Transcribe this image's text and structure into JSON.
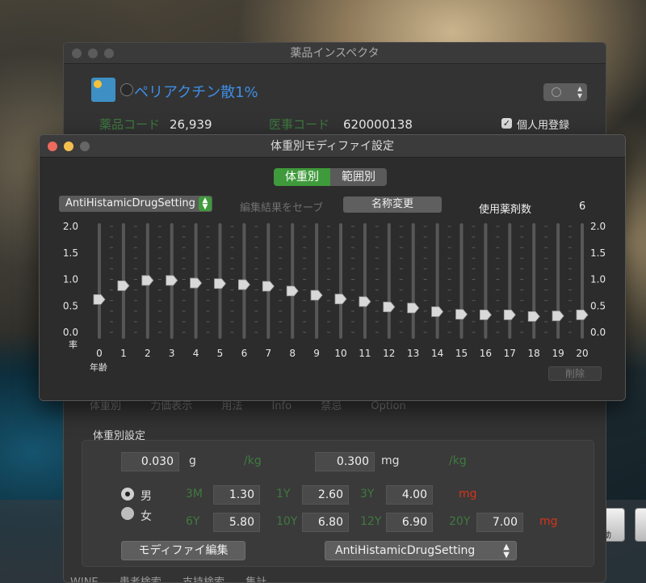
{
  "inspector": {
    "title": "薬品インスペクタ",
    "drug_name": "ペリアクチン散1%",
    "drug_code_label": "薬品コード",
    "drug_code_value": "26,939",
    "medical_code_label": "医事コード",
    "medical_code_value": "620000138",
    "personal_label": "個人用登録",
    "personal_checked": true,
    "hidden_tabs": [
      "体重別",
      "力価表示",
      "用法",
      "Info",
      "禁忌",
      "Option"
    ],
    "section_title": "体重別設定",
    "dose_g": "0.030",
    "unit_g": "g",
    "per_kg_1": "/kg",
    "dose_mg": "0.300",
    "unit_mg": "mg",
    "per_kg_2": "/kg",
    "sex_male": "男",
    "sex_female": "女",
    "age_labels": {
      "m3": "3M",
      "y1": "1Y",
      "y3": "3Y",
      "y6": "6Y",
      "y10": "10Y",
      "y12": "12Y",
      "y20": "20Y"
    },
    "age_values": {
      "m3": "1.30",
      "y1": "2.60",
      "y3": "4.00",
      "y6": "5.80",
      "y10": "6.80",
      "y12": "6.90",
      "y20": "7.00"
    },
    "mg_label_1": "mg",
    "mg_label_2": "mg",
    "modify_button": "モディファイ編集",
    "setting_popup": "AntiHistamicDrugSetting",
    "bottom_tabs": [
      "WINE",
      "患者検索",
      "支持検索",
      "集計"
    ]
  },
  "dock": {
    "icon_label": "動"
  },
  "dialog": {
    "title": "体重別モディファイ設定",
    "segment_weight": "体重別",
    "segment_range": "範囲別",
    "setting_popup": "AntiHistamicDrugSetting",
    "save_label": "編集結果をセーブ",
    "rename_button": "名称変更",
    "drug_count_label": "使用薬剤数",
    "drug_count_value": "6",
    "delete_button": "削除"
  },
  "chart_data": {
    "type": "line",
    "ylabel": "率",
    "xlabel": "年齢",
    "ylim": [
      0,
      2
    ],
    "yticks": [
      "0.0",
      "0.5",
      "1.0",
      "1.5",
      "2.0"
    ],
    "categories": [
      "0",
      "1",
      "2",
      "3",
      "4",
      "5",
      "6",
      "7",
      "8",
      "9",
      "10",
      "11",
      "12",
      "13",
      "14",
      "15",
      "16",
      "17",
      "18",
      "19",
      "20"
    ],
    "values": [
      0.62,
      0.88,
      0.98,
      0.98,
      0.93,
      0.92,
      0.9,
      0.87,
      0.78,
      0.7,
      0.63,
      0.58,
      0.48,
      0.46,
      0.39,
      0.34,
      0.33,
      0.33,
      0.3,
      0.31,
      0.33
    ]
  }
}
